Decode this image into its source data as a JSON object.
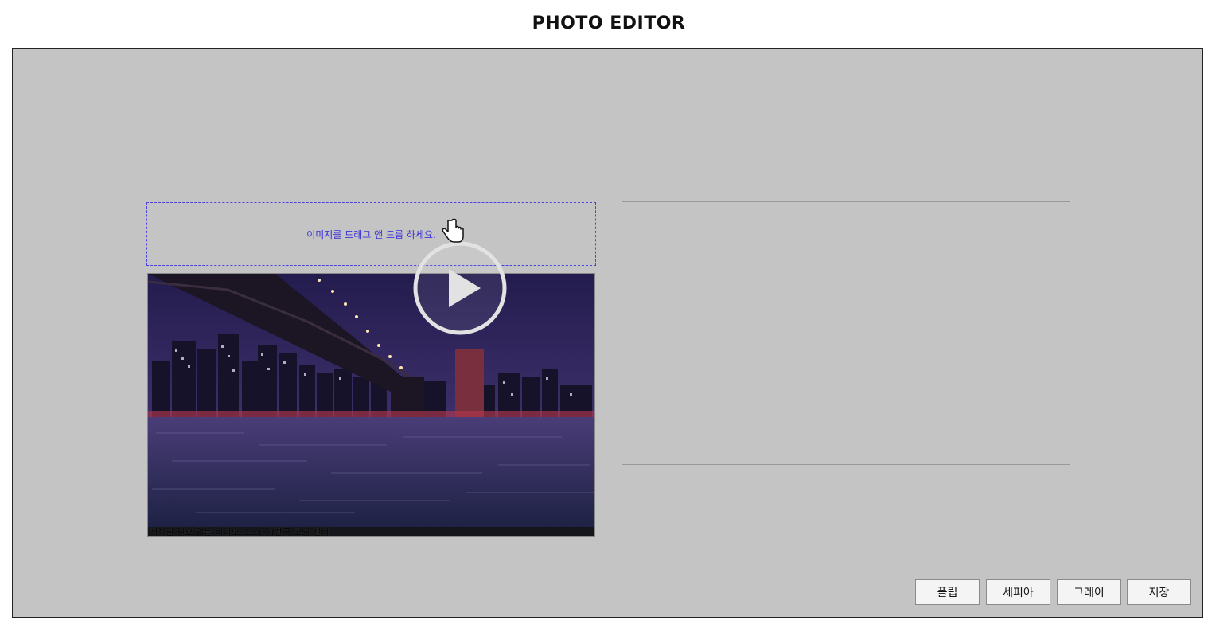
{
  "app": {
    "title": "PHOTO EDITOR"
  },
  "dropzone": {
    "hint": "이미지를 드래그 앤 드롭 하세요."
  },
  "preview": {
    "caption": "저작권 필요 없는 비디오 소스(주)한국 코딩 센터"
  },
  "toolbar": {
    "flip_label": "플립",
    "sepia_label": "세피아",
    "gray_label": "그레이",
    "save_label": "저장"
  }
}
